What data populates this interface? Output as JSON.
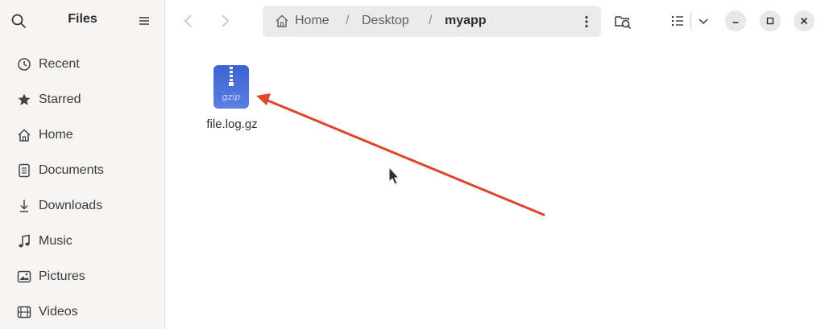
{
  "sidebar": {
    "title": "Files",
    "items": [
      {
        "label": "Recent",
        "icon": "clock-icon"
      },
      {
        "label": "Starred",
        "icon": "star-icon"
      },
      {
        "label": "Home",
        "icon": "home-icon"
      },
      {
        "label": "Documents",
        "icon": "document-icon"
      },
      {
        "label": "Downloads",
        "icon": "download-icon"
      },
      {
        "label": "Music",
        "icon": "music-icon"
      },
      {
        "label": "Pictures",
        "icon": "picture-icon"
      },
      {
        "label": "Videos",
        "icon": "video-icon"
      }
    ]
  },
  "pathbar": {
    "crumbs": [
      "Home",
      "Desktop",
      "myapp"
    ],
    "separator": "/"
  },
  "files": [
    {
      "name": "file.log.gz",
      "icon_text": "gzip",
      "icon": "gzip-archive-icon"
    }
  ],
  "colors": {
    "annotation_arrow": "#e0452b",
    "archive_icon": "#4a6fd8"
  }
}
